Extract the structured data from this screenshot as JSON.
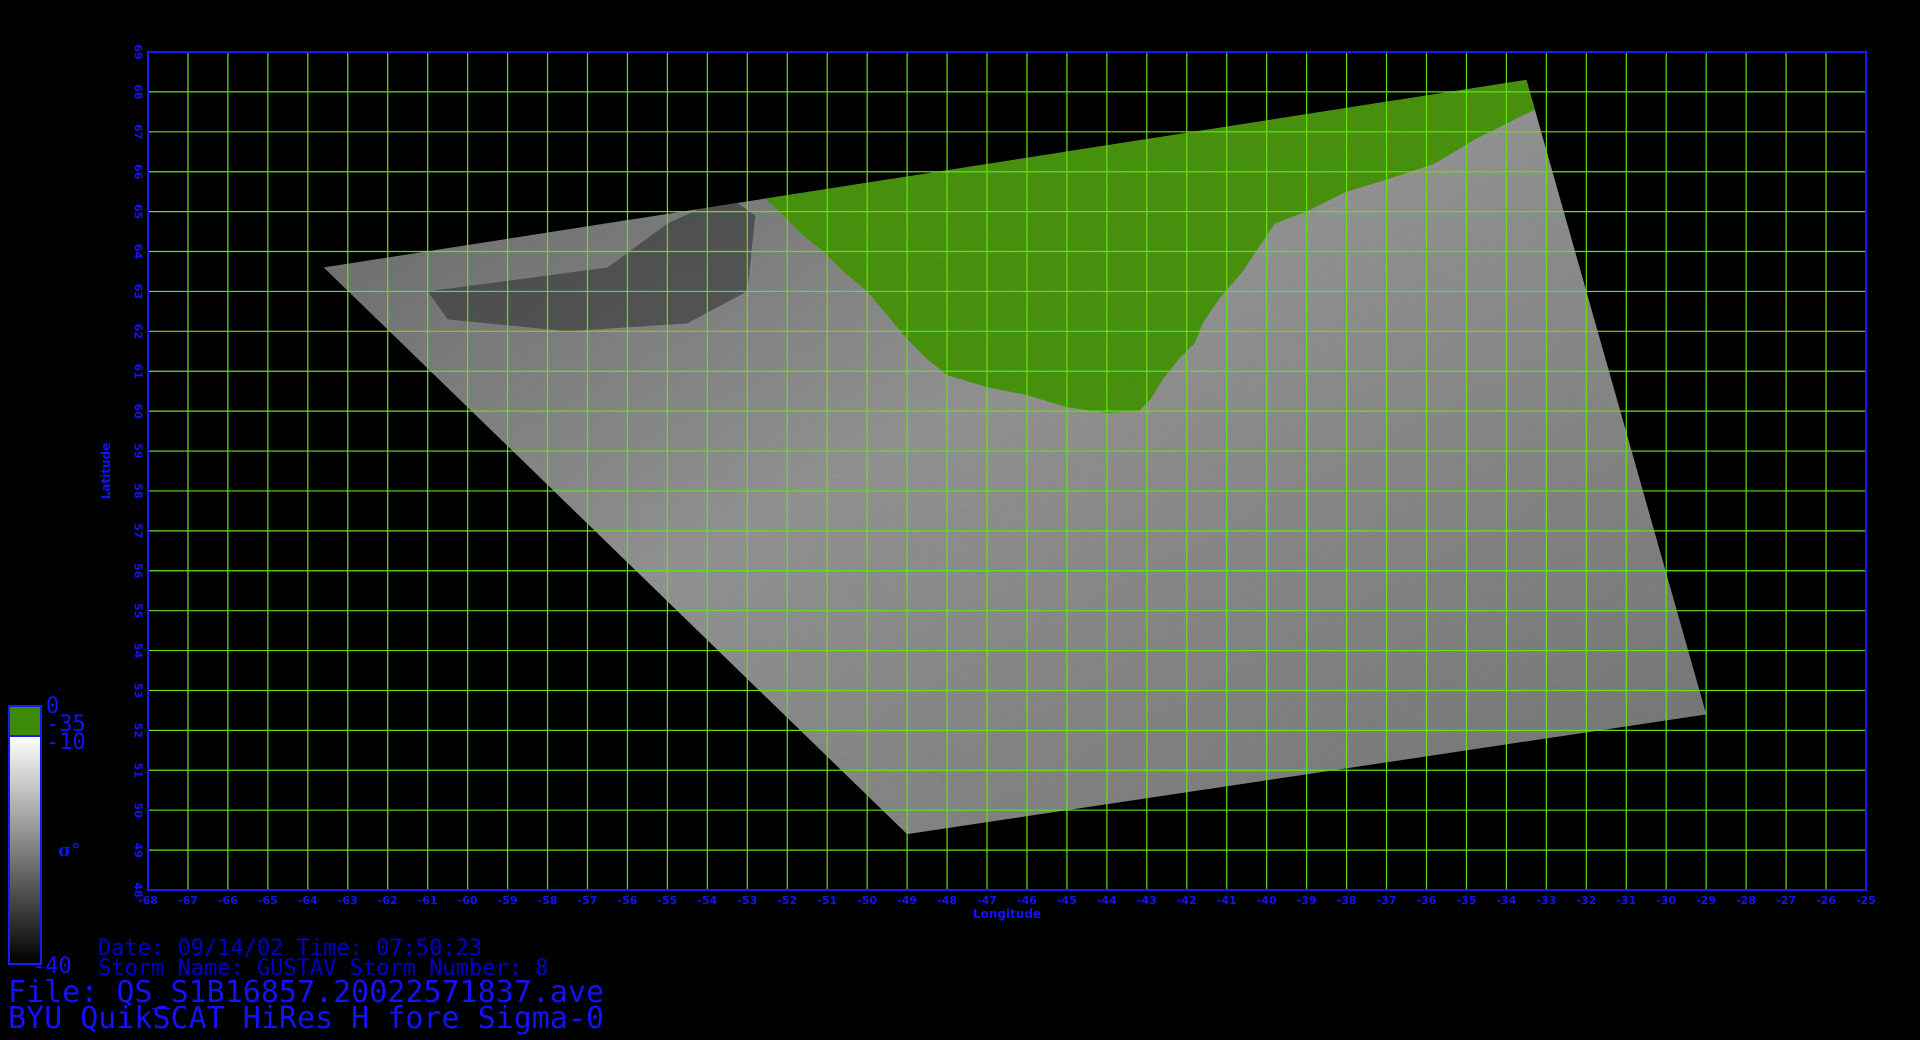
{
  "plot": {
    "x_axis_label": "Longitude",
    "y_axis_label": "Latitude",
    "lon_range": [
      -68,
      -25
    ],
    "lat_range": [
      48,
      69
    ],
    "lon_ticks": [
      -68,
      -67,
      -66,
      -65,
      -64,
      -63,
      -62,
      -61,
      -60,
      -59,
      -58,
      -57,
      -56,
      -55,
      -54,
      -53,
      -52,
      -51,
      -50,
      -49,
      -48,
      -47,
      -46,
      -45,
      -44,
      -43,
      -42,
      -41,
      -40,
      -39,
      -38,
      -37,
      -36,
      -35,
      -34,
      -33,
      -32,
      -31,
      -30,
      -29,
      -28,
      -27,
      -26,
      -25
    ],
    "lat_ticks": [
      48,
      49,
      50,
      51,
      52,
      53,
      54,
      55,
      56,
      57,
      58,
      59,
      60,
      61,
      62,
      63,
      64,
      65,
      66,
      67,
      68,
      69
    ],
    "grid": true,
    "colors": {
      "frame": "#1a1aff",
      "grid": "#66e016",
      "land": "#4c9a0c",
      "ocean_light": "#9a9a9a",
      "ocean_dark": "#3c3c3c",
      "text": "#1212ff"
    },
    "swath_corners_lonlat": [
      [
        -63.6,
        63.6
      ],
      [
        -33.5,
        68.3
      ],
      [
        -29.0,
        52.4
      ],
      [
        -49.0,
        49.4
      ]
    ],
    "land_mask": "green areas mark land (Greenland)"
  },
  "colorbar": {
    "max_label": "0",
    "land_label": "-35",
    "upper_label": "-10",
    "min_label": "-40",
    "quantity_label": "σ°",
    "colors": {
      "land": "#3c8a08",
      "top": "#ffffff",
      "bottom": "#000000"
    }
  },
  "info": {
    "date_line": "Date: 09/14/02   Time: 07:50:23",
    "storm_line": "Storm Name: GUSTAV   Storm Number: 8",
    "file_line": "File: QS_S1B16857.20022571837.ave",
    "title_line": "BYU QuikSCAT HiRes H fore Sigma-0"
  }
}
